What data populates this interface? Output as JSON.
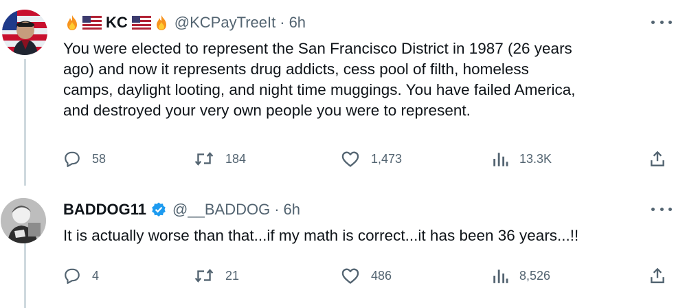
{
  "tweets": [
    {
      "display_name": "KC",
      "handle": "@KCPayTreeIt",
      "separator": "·",
      "time": "6h",
      "text_lines": [
        "You were elected to represent the San Francisco District in 1987 (26 years",
        "ago) and now it represents drug addicts, cess pool of filth, homeless",
        "camps, daylight looting, and night time muggings. You have failed America,",
        "and destroyed your very own people you were to represent."
      ],
      "replies": "58",
      "retweets": "184",
      "likes": "1,473",
      "views": "13.3K",
      "name_emojis": [
        "fire-emoji",
        "us-flag-emoji",
        "us-flag-emoji",
        "fire-emoji"
      ]
    },
    {
      "display_name": "BADDOG11",
      "handle": "@__BADDOG",
      "separator": "·",
      "time": "6h",
      "text_lines": [
        "It is actually worse than that...if my math is correct...it has been 36 years...!!"
      ],
      "replies": "4",
      "retweets": "21",
      "likes": "486",
      "views": "8,526",
      "verified": true
    }
  ],
  "colors": {
    "text_primary": "#0f1419",
    "text_secondary": "#536471",
    "thread_line": "#cfd9de",
    "verified_badge": "#1d9bf0"
  },
  "icons": [
    "reply-icon",
    "retweet-icon",
    "like-icon",
    "views-icon",
    "share-icon",
    "more-icon",
    "verified-badge-icon"
  ]
}
